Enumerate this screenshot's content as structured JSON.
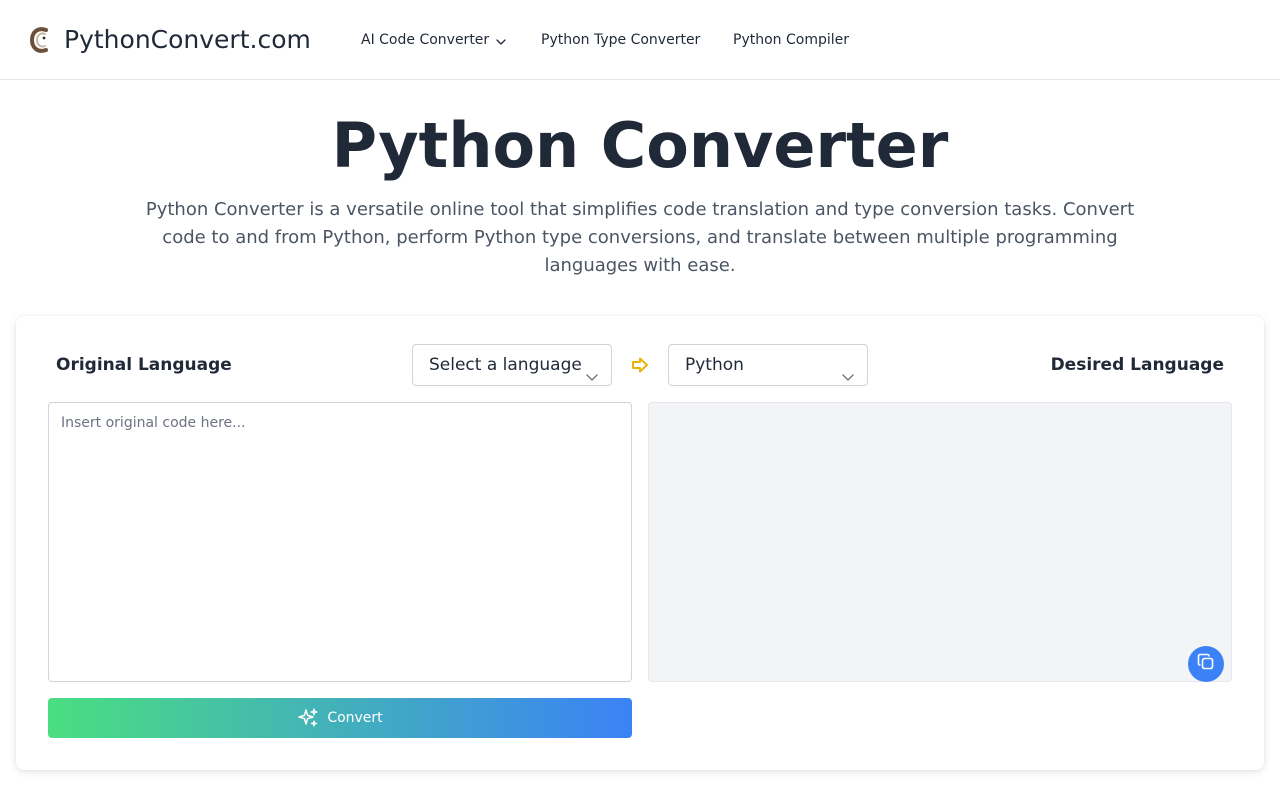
{
  "header": {
    "site_name": "PythonConvert.com",
    "logo_icon": "python-c-logo-icon",
    "nav": [
      {
        "label": "AI Code Converter",
        "has_dropdown": true,
        "icon": "chevron-down-icon"
      },
      {
        "label": "Python Type Converter"
      },
      {
        "label": "Python Compiler"
      }
    ]
  },
  "hero": {
    "title": "Python Converter",
    "description": "Python Converter is a versatile online tool that simplifies code translation and type conversion tasks. Convert code to and from Python, perform Python type conversions, and translate between multiple programming languages with ease."
  },
  "converter": {
    "original_label": "Original Language",
    "desired_label": "Desired Language",
    "source_select": {
      "value": "Select a language",
      "icon": "chevron-down-icon"
    },
    "target_select": {
      "value": "Python",
      "icon": "chevron-down-icon"
    },
    "arrow_icon": "arrow-right-icon",
    "input_placeholder": "Insert original code here...",
    "output_value": "",
    "copy_icon": "copy-icon",
    "convert_button": {
      "label": "Convert",
      "icon": "sparkles-icon"
    }
  },
  "colors": {
    "text_dark": "#1f2937",
    "text_muted": "#4b5563",
    "border": "#d1d5db",
    "output_bg": "#f3f4f6",
    "accent_blue": "#3b82f6",
    "accent_green": "#4ade80",
    "arrow_yellow": "#eab308"
  }
}
